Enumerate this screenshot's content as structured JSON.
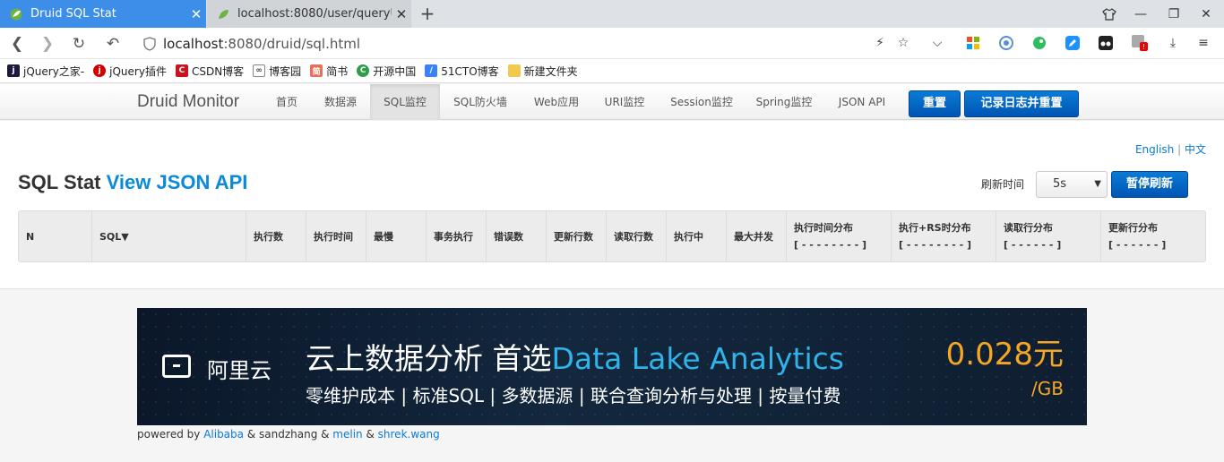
{
  "browser": {
    "tabs": [
      {
        "title": "Druid SQL Stat",
        "active": true
      },
      {
        "title": "localhost:8080/user/queryUs",
        "active": false
      }
    ],
    "url_host": "localhost",
    "url_rest": ":8080/druid/sql.html",
    "bookmarks": [
      {
        "label": "jQuery之家-",
        "color": "#1a1a3a"
      },
      {
        "label": "jQuery插件",
        "color": "#d00000"
      },
      {
        "label": "CSDN博客",
        "color": "#c9141d"
      },
      {
        "label": "博客园",
        "color": "#444444"
      },
      {
        "label": "简书",
        "color": "#ea6f5a"
      },
      {
        "label": "开源中国",
        "color": "#2e9c4a"
      },
      {
        "label": "51CTO博客",
        "color": "#3b82f6"
      },
      {
        "label": "新建文件夹",
        "color": "#f2c94c"
      }
    ]
  },
  "nav": {
    "brand": "Druid Monitor",
    "links": [
      "首页",
      "数据源",
      "SQL监控",
      "SQL防火墙",
      "Web应用",
      "URI监控",
      "Session监控",
      "Spring监控",
      "JSON API"
    ],
    "reset": "重置",
    "log_reset": "记录日志并重置"
  },
  "page": {
    "lang_en": "English",
    "lang_sep": "|",
    "lang_cn": "中文",
    "title": "SQL Stat",
    "title_link": "View JSON API",
    "refresh_label": "刷新时间",
    "refresh_value": "5s",
    "pause": "暂停刷新"
  },
  "table": {
    "columns": [
      "N",
      "SQL▼",
      "执行数",
      "执行时间",
      "最慢",
      "事务执行",
      "错误数",
      "更新行数",
      "读取行数",
      "执行中",
      "最大并发"
    ],
    "dist_columns": [
      {
        "title": "执行时间分布",
        "sub": "[ - - - - - - - - ]"
      },
      {
        "title": "执行+RS时分布",
        "sub": "[ - - - - - - - - ]"
      },
      {
        "title": "读取行分布",
        "sub": "[ - - - - - - ]"
      },
      {
        "title": "更新行分布",
        "sub": "[ - - - - - - ]"
      }
    ]
  },
  "banner": {
    "logo": "阿里云",
    "headline_a": "云上数据分析 首选",
    "headline_b": "Data Lake Analytics",
    "sub": "零维护成本 | 标准SQL | 多数据源 | 联合查询分析与处理 | 按量付费",
    "price": "0.028元",
    "unit": "/GB"
  },
  "footer": {
    "prefix": "powered by ",
    "alibaba": "Alibaba",
    "sep1": " & sandzhang & ",
    "melin": "melin",
    "sep2": " & ",
    "shrek": "shrek.wang"
  }
}
